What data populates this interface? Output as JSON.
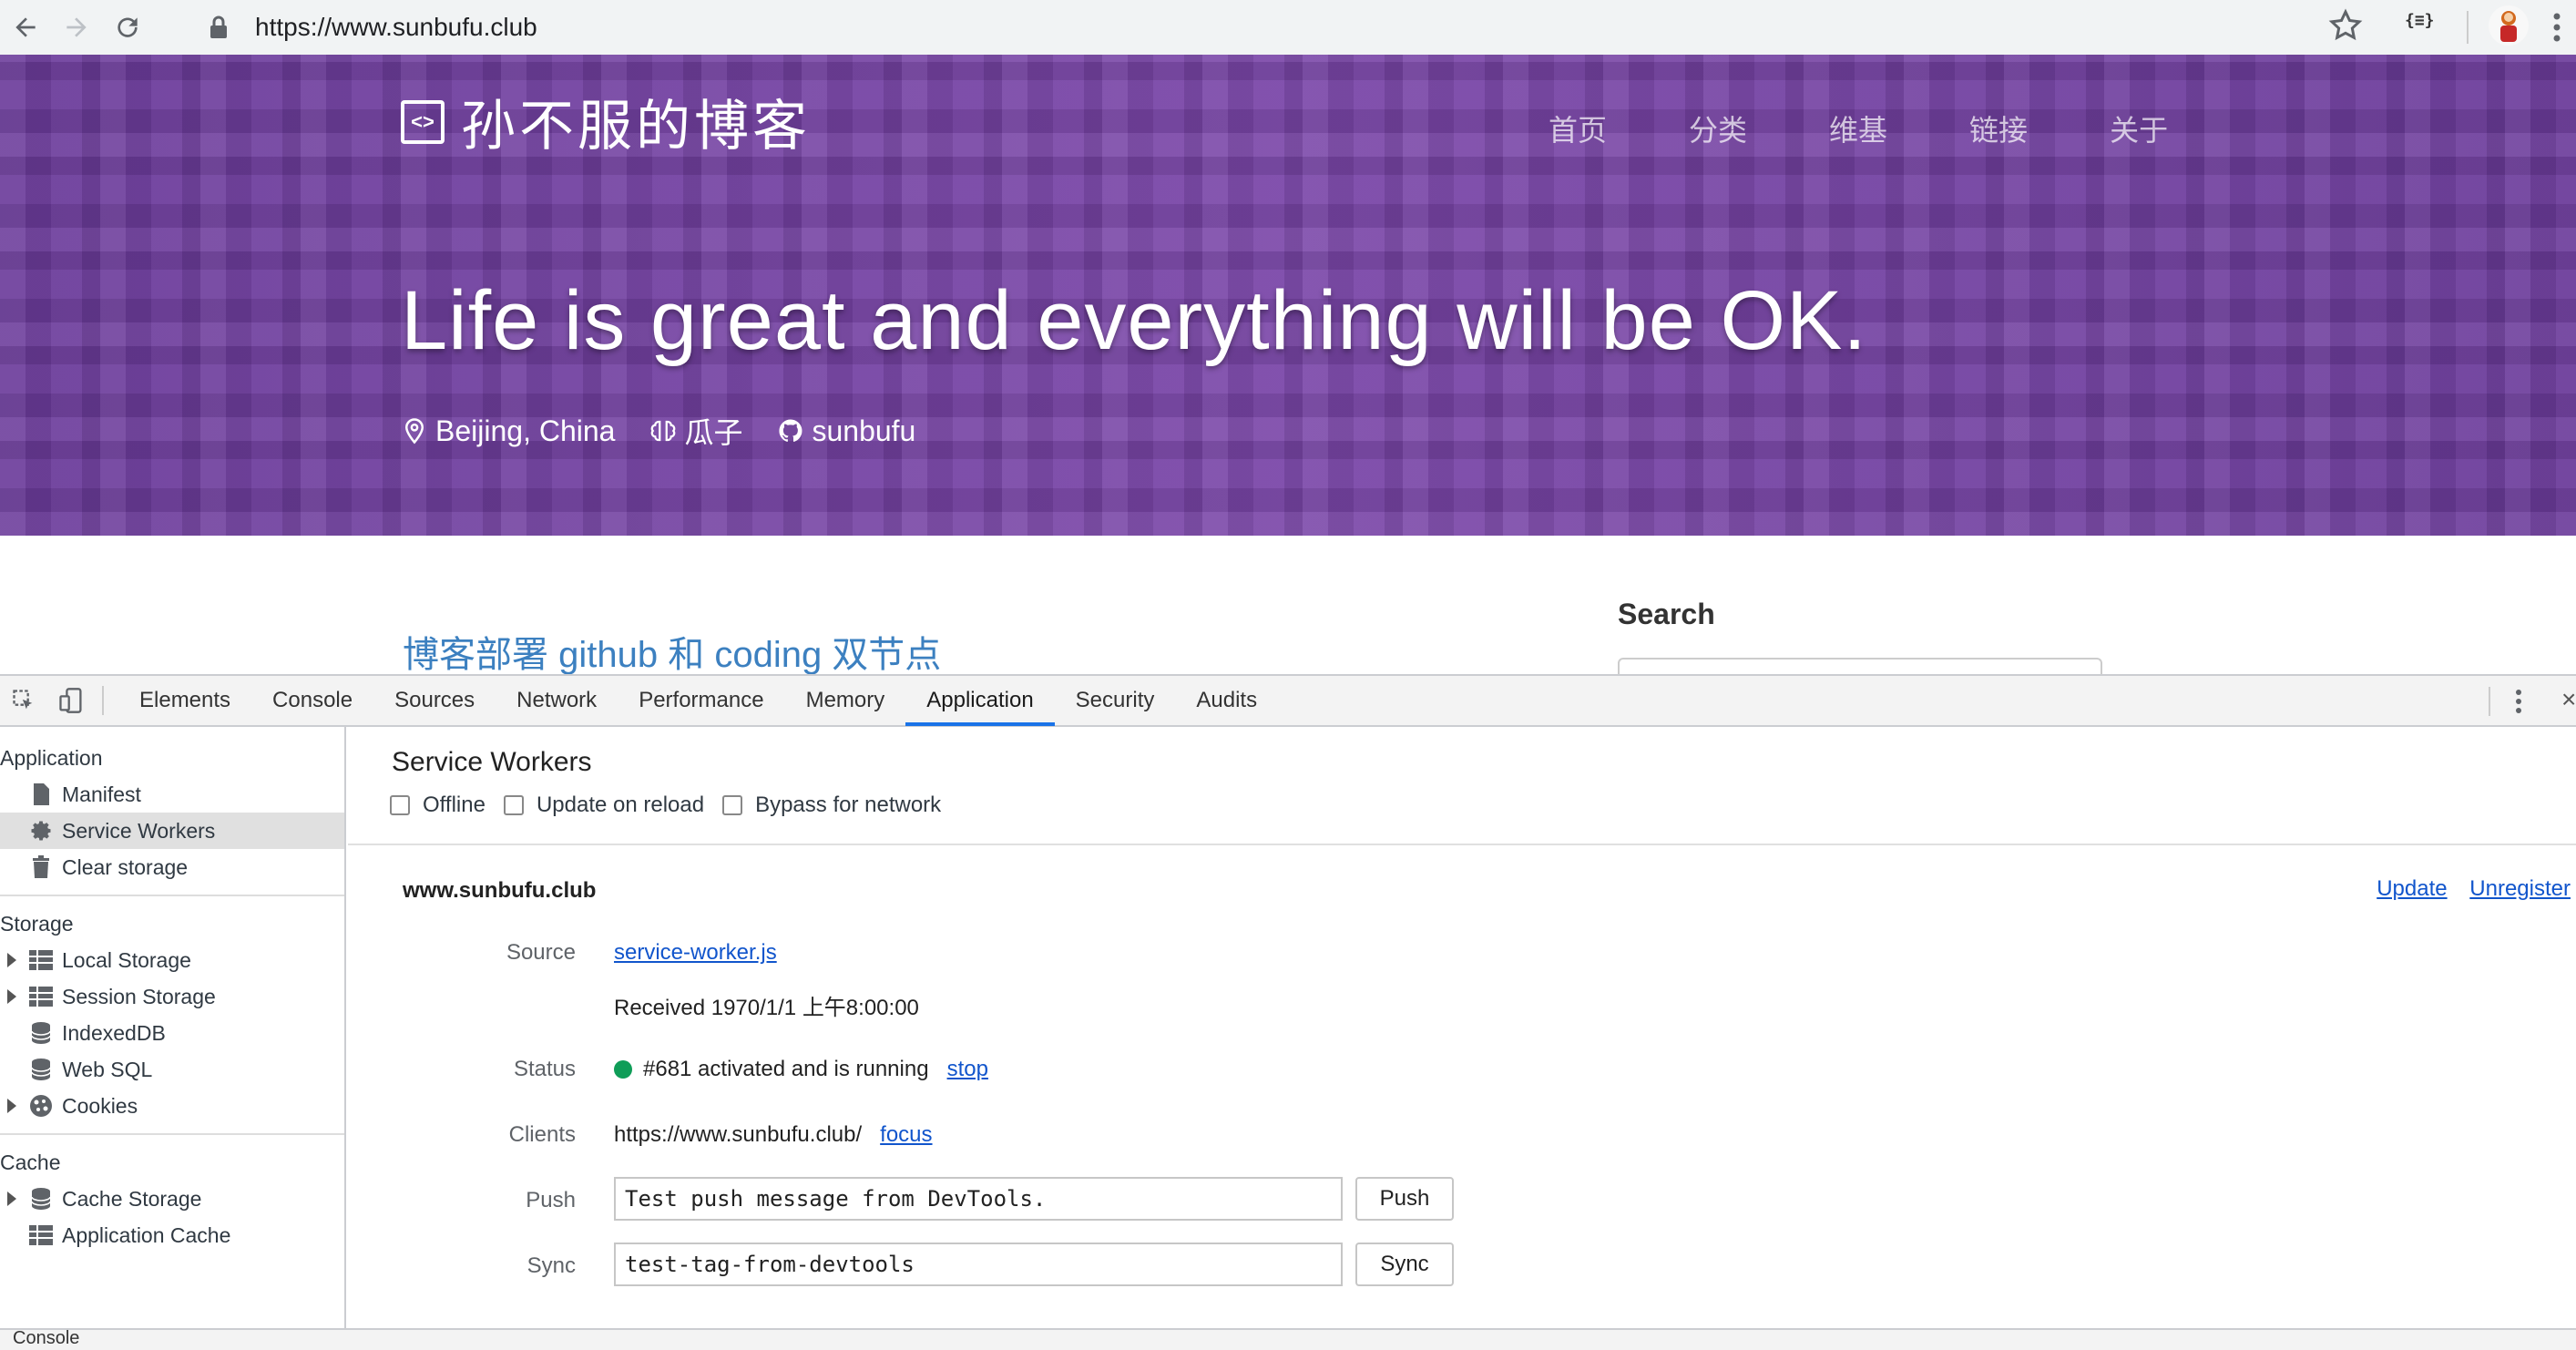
{
  "browser": {
    "url": "https://www.sunbufu.club",
    "extension_label": "{≡}"
  },
  "blog": {
    "brand_icon_text": "<>",
    "title": "孙不服的博客",
    "nav": [
      "首页",
      "分类",
      "维基",
      "链接",
      "关于"
    ],
    "tagline": "Life is great and everything will be OK.",
    "location": "Beijing, China",
    "nickname": "瓜子",
    "github": "sunbufu",
    "post_title": "博客部署 github 和 coding 双节点",
    "search_heading": "Search"
  },
  "devtools": {
    "tabs": [
      "Elements",
      "Console",
      "Sources",
      "Network",
      "Performance",
      "Memory",
      "Application",
      "Security",
      "Audits"
    ],
    "active_tab": "Application",
    "sidebar": {
      "application_heading": "Application",
      "application_items": [
        "Manifest",
        "Service Workers",
        "Clear storage"
      ],
      "storage_heading": "Storage",
      "storage_items": [
        "Local Storage",
        "Session Storage",
        "IndexedDB",
        "Web SQL",
        "Cookies"
      ],
      "cache_heading": "Cache",
      "cache_items": [
        "Cache Storage",
        "Application Cache"
      ]
    },
    "service_workers": {
      "title": "Service Workers",
      "options": [
        "Offline",
        "Update on reload",
        "Bypass for network"
      ],
      "origin": "www.sunbufu.club",
      "update_label": "Update",
      "unregister_label": "Unregister",
      "source_label": "Source",
      "source_file": "service-worker.js",
      "received": "Received 1970/1/1 上午8:00:00",
      "status_label": "Status",
      "status_text": "#681 activated and is running",
      "status_color": "#0f9d58",
      "stop_label": "stop",
      "clients_label": "Clients",
      "clients_url": "https://www.sunbufu.club/",
      "focus_label": "focus",
      "push_label": "Push",
      "push_value": "Test push message from DevTools.",
      "push_button": "Push",
      "sync_label": "Sync",
      "sync_value": "test-tag-from-devtools",
      "sync_button": "Sync"
    },
    "drawer_label": "Console"
  }
}
